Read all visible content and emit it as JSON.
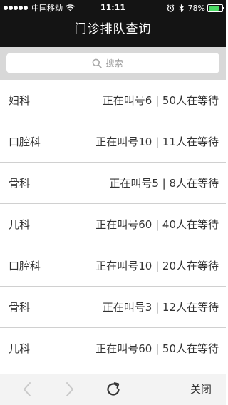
{
  "status_bar": {
    "carrier": "中国移动",
    "time": "11:11",
    "battery_percent": "78%",
    "battery_level": 0.78,
    "battery_color": "#4cd964",
    "icons": [
      "signal-dots",
      "wifi-icon",
      "alarm-icon",
      "bluetooth-icon",
      "battery-icon"
    ]
  },
  "header": {
    "title": "门诊排队查询",
    "background": "#141414"
  },
  "search": {
    "placeholder": "搜索",
    "value": ""
  },
  "departments": [
    {
      "name": "妇科",
      "queue": "正在叫号6 | 50人在等待"
    },
    {
      "name": "口腔科",
      "queue": "正在叫号10 | 11人在等待"
    },
    {
      "name": "骨科",
      "queue": "正在叫号5 | 8人在等待"
    },
    {
      "name": "儿科",
      "queue": "正在叫号60 | 40人在等待"
    },
    {
      "name": "口腔科",
      "queue": "正在叫号10 | 20人在等待"
    },
    {
      "name": "骨科",
      "queue": "正在叫号3 | 12人在等待"
    },
    {
      "name": "儿科",
      "queue": "正在叫号60 | 50人在等待"
    }
  ],
  "toolbar": {
    "back_icon": "chevron-left-icon",
    "forward_icon": "chevron-right-icon",
    "refresh_icon": "refresh-icon",
    "close_label": "关闭"
  }
}
